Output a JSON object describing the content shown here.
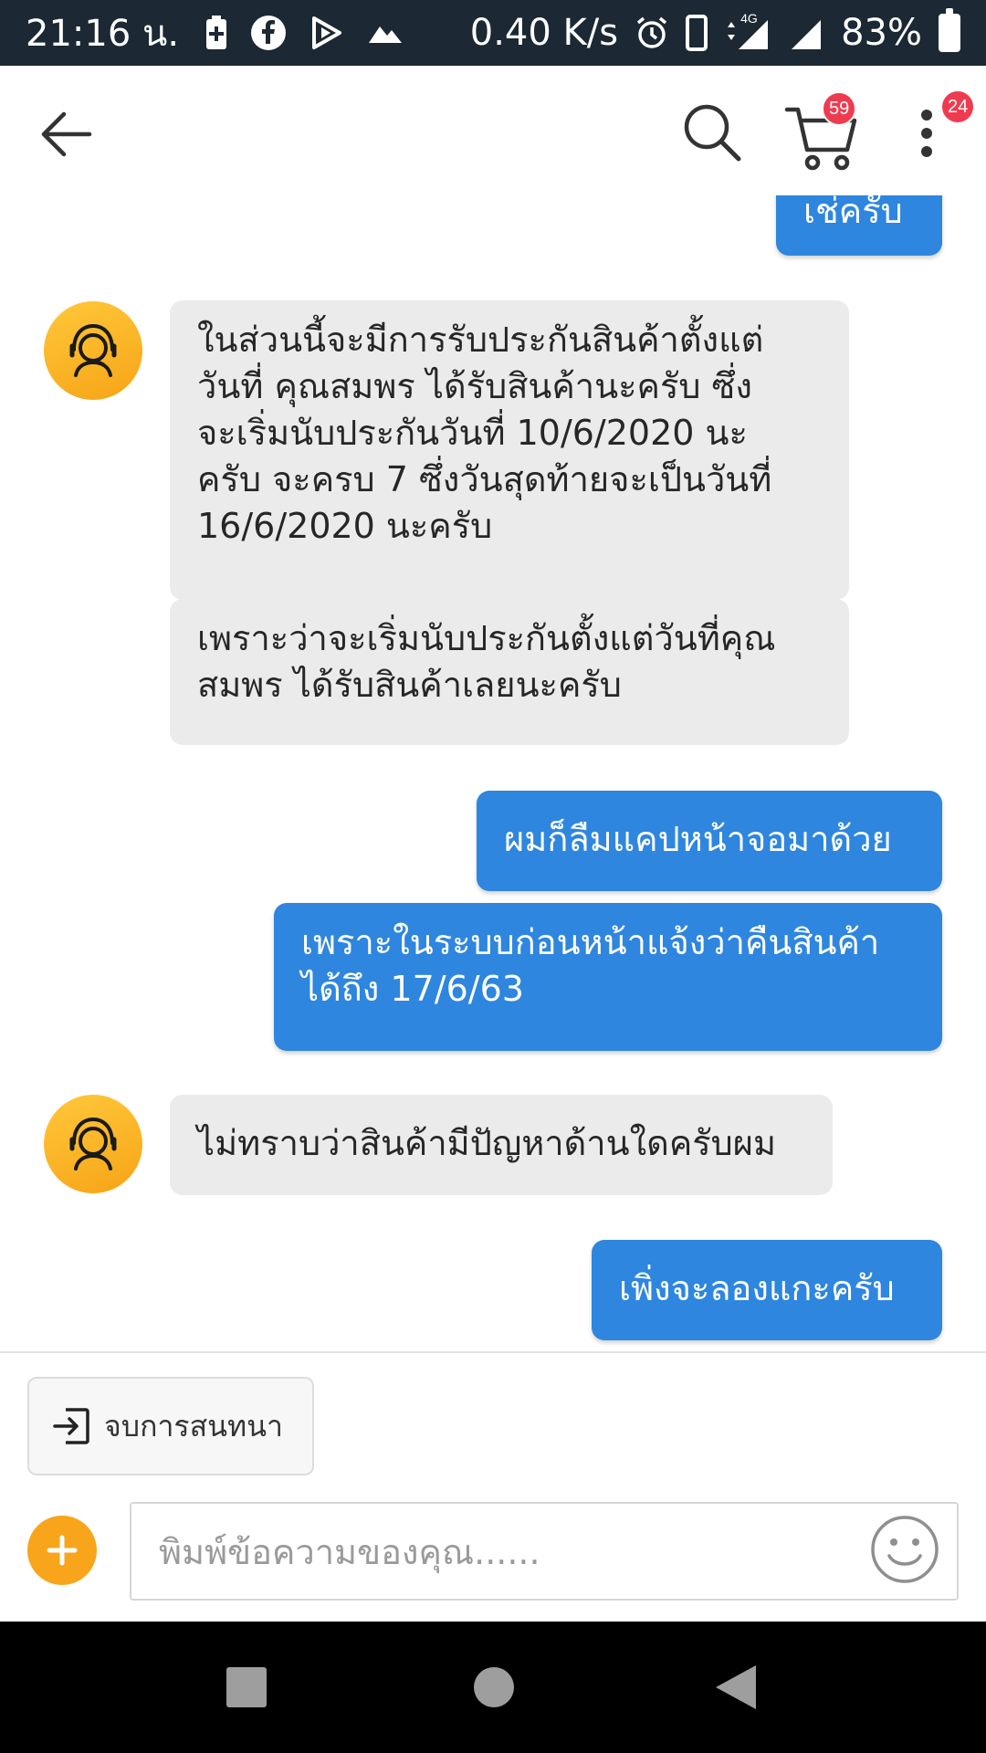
{
  "status_bar": {
    "time": "21:16 น.",
    "net_speed": "0.40 K/s",
    "network": "4G",
    "battery": "83%"
  },
  "header": {
    "cart_badge": "59",
    "more_badge": "24"
  },
  "messages": [
    {
      "from": "me",
      "text": "เช่ครับ"
    },
    {
      "from": "agent",
      "text": "ในส่วนนี้จะมีการรับประกันสินค้าตั้งแต่\nวันที่ คุณสมพร ได้รับสินค้านะครับ ซึ่ง\nจะเริ่มนับประกันวันที่ 10/6/2020 นะ\nครับ จะครบ 7 ซึ่งวันสุดท้ายจะเป็นวันที่\n16/6/2020 นะครับ"
    },
    {
      "from": "agent",
      "text": "เพราะว่าจะเริ่มนับประกันตั้งแต่วันที่คุณ\nสมพร ได้รับสินค้าเลยนะครับ"
    },
    {
      "from": "me",
      "text": "ผมก็ลืมแคปหน้าจอมาด้วย"
    },
    {
      "from": "me",
      "text": "เพราะในระบบก่อนหน้าแจ้งว่าคืนสินค้า\nได้ถึง 17/6/63"
    },
    {
      "from": "agent",
      "text": "ไม่ทราบว่าสินค้ามีปัญหาด้านใดครับผม"
    },
    {
      "from": "me",
      "text": "เพิ่งจะลองแกะครับ"
    }
  ],
  "footer": {
    "end_chat_label": "จบการสนทนา",
    "input_placeholder": "พิมพ์ข้อความของคุณ......"
  },
  "colors": {
    "status_bar": "#1c2833",
    "my_bubble": "#2e86de",
    "agent_bubble": "#ebebeb",
    "accent": "#f8a51c",
    "badge": "#ef3b50"
  }
}
